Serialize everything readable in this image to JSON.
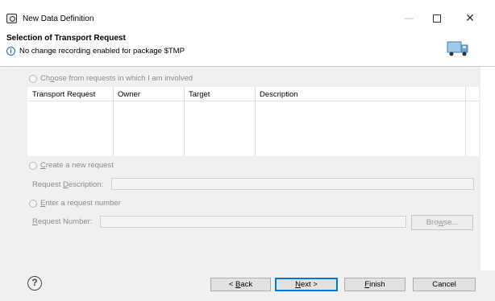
{
  "window": {
    "title": "New Data Definition",
    "icon": "eclipse-app-icon"
  },
  "header": {
    "title": "Selection of Transport Request",
    "message": "No change recording enabled for package $TMP",
    "message_icon": "info-icon",
    "banner_icon": "transport-truck-icon"
  },
  "options": {
    "choose_label_pre": "Ch",
    "choose_label_u": "o",
    "choose_label_post": "ose from requests in which I am involved",
    "create_label_u": "C",
    "create_label_post": "reate a new request",
    "enter_label_u": "E",
    "enter_label_post": "nter a request number"
  },
  "table": {
    "columns": [
      "Transport Request",
      "Owner",
      "Target",
      "Description"
    ],
    "rows": []
  },
  "fields": {
    "request_description_pre": "Request ",
    "request_description_u": "D",
    "request_description_post": "escription:",
    "request_description_value": "",
    "request_number_u": "R",
    "request_number_post": "equest Number:",
    "request_number_value": "",
    "browse_pre": "Bro",
    "browse_u": "w",
    "browse_post": "se..."
  },
  "footer": {
    "back_pre": "< ",
    "back_u": "B",
    "back_post": "ack",
    "next_u": "N",
    "next_post": "ext >",
    "finish_u": "F",
    "finish_post": "inish",
    "cancel": "Cancel"
  }
}
